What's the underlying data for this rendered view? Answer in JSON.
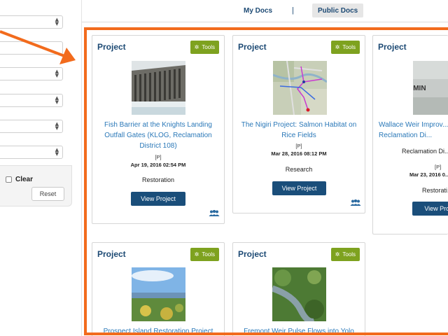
{
  "nav": {
    "my_docs": "My Docs",
    "separator": "|",
    "public_docs": "Public Docs"
  },
  "sidebar": {
    "clear_label": "Clear",
    "reset_label": "Reset"
  },
  "cards": [
    {
      "title": "Project",
      "tools_label": "Tools",
      "name": "Fish Barrier at the Knights Landing Outfall Gates (KLOG, Reclamation District 108)",
      "privacy": "[P]",
      "date": "Apr 19, 2016 02:54 PM",
      "category": "Restoration",
      "view_label": "View Project"
    },
    {
      "title": "Project",
      "tools_label": "Tools",
      "name": "The Nigiri Project: Salmon Habitat on Rice Fields",
      "privacy": "[P]",
      "date": "Mar 28, 2016 08:12 PM",
      "category": "Research",
      "view_label": "View Project"
    },
    {
      "title": "Project",
      "name": "Wallace Weir Improv... Reclamation Di...",
      "subtitle": "Reclamation Di...",
      "privacy": "[P]",
      "date": "Mar 23, 2016 0...",
      "category": "Restorati...",
      "view_label": "View Proj...",
      "thumb_text": "GE COMIN"
    },
    {
      "title": "Project",
      "tools_label": "Tools",
      "name": "Prospect Island Restoration Project"
    },
    {
      "title": "Project",
      "tools_label": "Tools",
      "name": "Fremont Weir Pulse Flows into Yolo"
    }
  ],
  "colors": {
    "accent_orange": "#f26b1d",
    "link_blue": "#2a78b8",
    "title_navy": "#1d4a74",
    "tools_green": "#7ea21f",
    "button_navy": "#1a4e7a"
  },
  "icons": {
    "tools": "gear-icon",
    "shared": "users-icon",
    "select_arrows": "updown-arrows-icon"
  }
}
